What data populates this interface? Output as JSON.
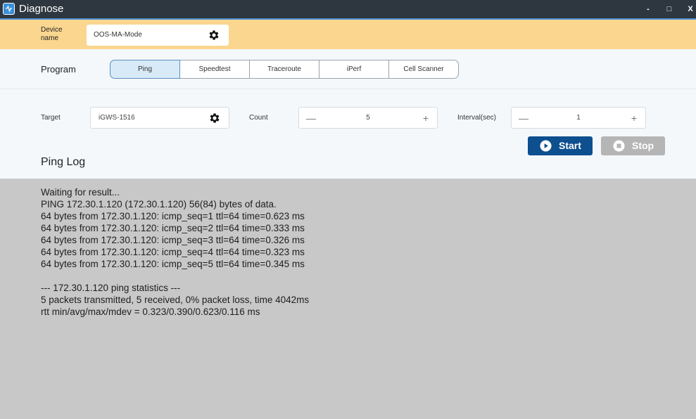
{
  "window": {
    "title": "Diagnose",
    "controls": {
      "minimize": "-",
      "maximize": "□",
      "close": "X"
    }
  },
  "device": {
    "label": "Device name",
    "value": "OOS-MA-Mode",
    "icon": "gear-icon"
  },
  "program": {
    "label": "Program",
    "tabs": [
      {
        "label": "Ping",
        "active": true
      },
      {
        "label": "Speedtest",
        "active": false
      },
      {
        "label": "Traceroute",
        "active": false
      },
      {
        "label": "iPerf",
        "active": false
      },
      {
        "label": "Cell Scanner",
        "active": false
      }
    ]
  },
  "target": {
    "label": "Target",
    "value": "iGWS-1516",
    "icon": "gear-icon"
  },
  "count": {
    "label": "Count",
    "value": "5",
    "minus": "—",
    "plus": "+"
  },
  "interval": {
    "label": "Interval(sec)",
    "value": "1",
    "minus": "—",
    "plus": "+"
  },
  "actions": {
    "start_label": "Start",
    "stop_label": "Stop"
  },
  "log": {
    "title": "Ping Log",
    "lines": [
      "Waiting for result...",
      "PING 172.30.1.120 (172.30.1.120) 56(84) bytes of data.",
      "64 bytes from 172.30.1.120: icmp_seq=1 ttl=64 time=0.623 ms",
      "64 bytes from 172.30.1.120: icmp_seq=2 ttl=64 time=0.333 ms",
      "64 bytes from 172.30.1.120: icmp_seq=3 ttl=64 time=0.326 ms",
      "64 bytes from 172.30.1.120: icmp_seq=4 ttl=64 time=0.323 ms",
      "64 bytes from 172.30.1.120: icmp_seq=5 ttl=64 time=0.345 ms",
      "",
      "--- 172.30.1.120 ping statistics ---",
      "5 packets transmitted, 5 received, 0% packet loss, time 4042ms",
      "rtt min/avg/max/mdev = 0.323/0.390/0.623/0.116 ms"
    ]
  },
  "colors": {
    "titlebar": "#2e3740",
    "device_bar": "#fad68f",
    "start_button": "#0d4f8f",
    "stop_button": "#b5b5b5",
    "log_background": "#c8c8c8"
  }
}
